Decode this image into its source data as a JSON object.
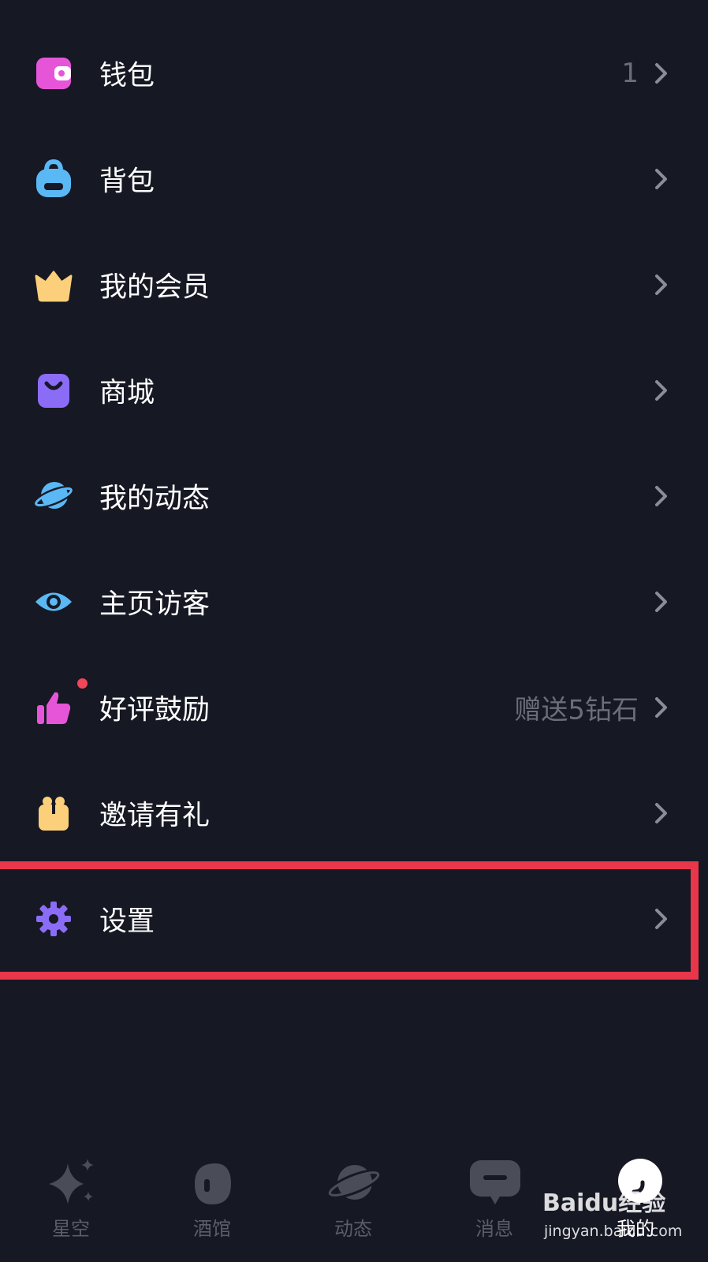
{
  "menu": {
    "items": [
      {
        "label": "钱包",
        "value": "1",
        "icon": "wallet-icon"
      },
      {
        "label": "背包",
        "value": "",
        "icon": "backpack-icon"
      },
      {
        "label": "我的会员",
        "value": "",
        "icon": "crown-icon"
      },
      {
        "label": "商城",
        "value": "",
        "icon": "shopping-bag-icon"
      },
      {
        "label": "我的动态",
        "value": "",
        "icon": "planet-icon"
      },
      {
        "label": "主页访客",
        "value": "",
        "icon": "eye-icon"
      },
      {
        "label": "好评鼓励",
        "value": "赠送5钻石",
        "icon": "thumbs-up-icon"
      },
      {
        "label": "邀请有礼",
        "value": "",
        "icon": "gift-icon"
      },
      {
        "label": "设置",
        "value": "",
        "icon": "gear-icon"
      }
    ]
  },
  "tabbar": {
    "tabs": [
      {
        "label": "星空",
        "icon": "sparkle-icon"
      },
      {
        "label": "酒馆",
        "icon": "tavern-icon"
      },
      {
        "label": "动态",
        "icon": "planet-icon"
      },
      {
        "label": "消息",
        "icon": "message-icon"
      },
      {
        "label": "我的",
        "icon": "profile-icon",
        "active": true
      }
    ]
  },
  "watermark": {
    "brand": "Baidu经验",
    "url": "jingyan.baidu.com"
  },
  "colors": {
    "background": "#161823",
    "highlight": "#e8364a",
    "text": "#ffffff",
    "muted": "#6b6e78",
    "badge": "#f0465a"
  }
}
